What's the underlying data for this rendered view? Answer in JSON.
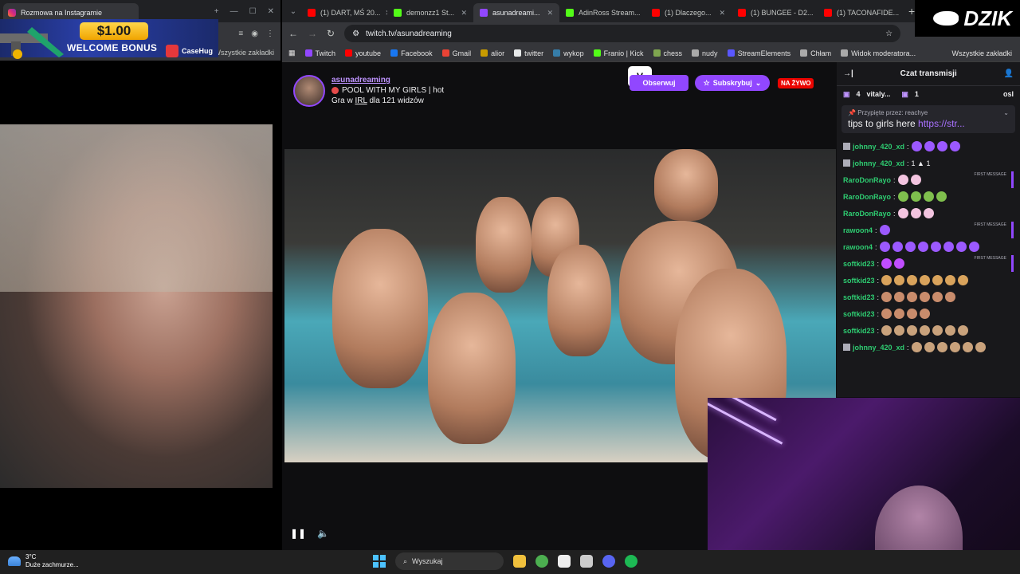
{
  "left_window": {
    "tab_title": "Rozmowa na Instagramie",
    "bookmarks_label": "Wszystkie zakładki",
    "promo": {
      "amount": "$1.00",
      "text": "WELCOME BONUS",
      "brand": "CaseHug"
    }
  },
  "browser": {
    "tabs": [
      {
        "label": "(1) DART, MŚ 20...",
        "color": "#ff0000"
      },
      {
        "label": "demonzz1 St...",
        "color": "#53fc18"
      },
      {
        "label": "asunadreami...",
        "color": "#9147ff",
        "active": true
      },
      {
        "label": "AdinRoss Stream...",
        "color": "#53fc18"
      },
      {
        "label": "(1) Dlaczego...",
        "color": "#ff0000"
      },
      {
        "label": "(1) BUNGEE - D2...",
        "color": "#ff0000"
      },
      {
        "label": "(1) TACONAFIDE...",
        "color": "#ff0000"
      }
    ],
    "url": "twitch.tv/asunadreaming",
    "bookmarks": [
      {
        "label": "Twitch",
        "color": "#9147ff"
      },
      {
        "label": "youtube",
        "color": "#ff0000"
      },
      {
        "label": "Facebook",
        "color": "#1877f2"
      },
      {
        "label": "Gmail",
        "color": "#ea4335"
      },
      {
        "label": "alior",
        "color": "#c89b00"
      },
      {
        "label": "twitter",
        "color": "#e7e9ea"
      },
      {
        "label": "wykop",
        "color": "#367da9"
      },
      {
        "label": "Franio | Kick",
        "color": "#53fc18"
      },
      {
        "label": "chess",
        "color": "#7fa650"
      },
      {
        "label": "nudy",
        "color": "#aaaaaa"
      },
      {
        "label": "StreamElements",
        "color": "#5a57ff"
      },
      {
        "label": "Chłam",
        "color": "#aaaaaa"
      },
      {
        "label": "Widok moderatora...",
        "color": "#aaaaaa"
      }
    ],
    "all_bookmarks": "Wszystkie zakładki"
  },
  "channel": {
    "name": "asunadreaming",
    "title": "POOL WITH MY GIRLS | hot",
    "game_prefix": "Gra w",
    "game": "IRL",
    "viewers": "dla 121 widzów",
    "follow_label": "Obserwuj",
    "subscribe_label": "Subskrybuj",
    "live_label": "NA ŻYWO"
  },
  "chat": {
    "header": "Czat transmisji",
    "gift_count": "4",
    "gift_user": "vitaly...",
    "gift_count2": "1",
    "gift_user2": "osl",
    "pinned_by": "Przypięte przez:",
    "pinned_user": "reachye",
    "pinned_text": "tips to girls here",
    "pinned_link": "https://str...",
    "first_message_tag": "FIRST MESSAGE",
    "messages": [
      {
        "user": "johnny_420_xd",
        "color": "#2ecc71",
        "emotes": 4,
        "emote_color": "#9b59ff"
      },
      {
        "user": "johnny_420_xd",
        "color": "#2ecc71",
        "text": "1 ▲ 1"
      },
      {
        "user": "RaroDonRayo",
        "color": "#2ecc71",
        "emotes": 2,
        "emote_color": "#f3c4e0",
        "first": true
      },
      {
        "user": "RaroDonRayo",
        "color": "#2ecc71",
        "emotes": 4,
        "emote_color": "#7fbf4d"
      },
      {
        "user": "RaroDonRayo",
        "color": "#2ecc71",
        "emotes": 3,
        "emote_color": "#f3c4e0"
      },
      {
        "user": "rawoon4",
        "color": "#2ecc71",
        "emotes": 1,
        "emote_color": "#9b59ff",
        "first": true
      },
      {
        "user": "rawoon4",
        "color": "#2ecc71",
        "emotes": 8,
        "emote_color": "#9b59ff"
      },
      {
        "user": "softkid23",
        "color": "#2ecc71",
        "emotes": 2,
        "emote_color": "#c04dff",
        "first": true
      },
      {
        "user": "softkid23",
        "color": "#2ecc71",
        "emotes": 7,
        "emote_color": "#d9a35c"
      },
      {
        "user": "softkid23",
        "color": "#2ecc71",
        "emotes": 6,
        "emote_color": "#c98c6c"
      },
      {
        "user": "softkid23",
        "color": "#2ecc71",
        "emotes": 4,
        "emote_color": "#c98c6c"
      },
      {
        "user": "softkid23",
        "color": "#2ecc71",
        "emotes": 7,
        "emote_color": "#c9a27c"
      },
      {
        "user": "johnny_420_xd",
        "color": "#2ecc71",
        "emotes": 6,
        "emote_color": "#c9a27c"
      }
    ]
  },
  "dzik": "DZIK",
  "taskbar": {
    "temp": "3°C",
    "weather": "Duże zachmurze...",
    "search": "Wyszukaj"
  }
}
